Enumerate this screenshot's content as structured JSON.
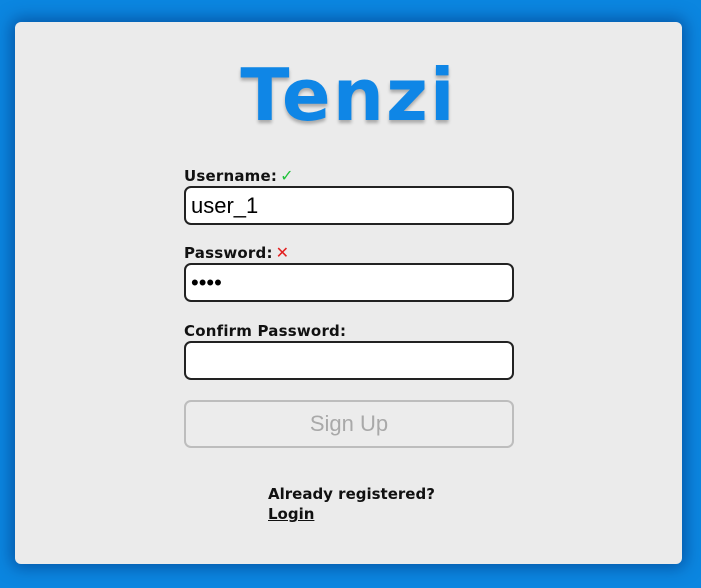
{
  "app": {
    "logo_text": "Tenzi",
    "brand_color": "#0f86e6",
    "background_color": "#0b86e0"
  },
  "form": {
    "username": {
      "label": "Username:",
      "status_icon": "check-icon",
      "status_glyph": "✓",
      "value": "user_1"
    },
    "password": {
      "label": "Password:",
      "status_icon": "cross-icon",
      "status_glyph": "✕",
      "value": "abcd"
    },
    "confirm_password": {
      "label": "Confirm Password:",
      "value": ""
    },
    "submit_label": "Sign Up"
  },
  "footer": {
    "prompt": "Already registered?",
    "login_link": "Login"
  }
}
